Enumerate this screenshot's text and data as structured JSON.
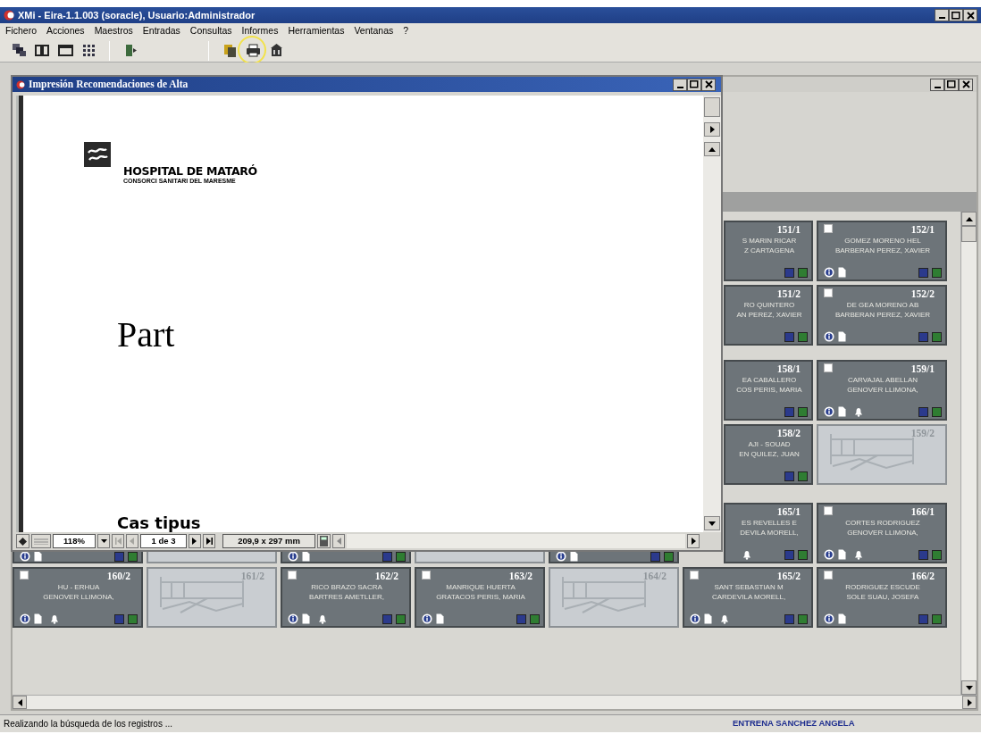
{
  "window": {
    "title": "XMi - Eira-1.1.003 (soracle), Usuario:Administrador"
  },
  "menu": [
    "Fichero",
    "Acciones",
    "Maestros",
    "Entradas",
    "Consultas",
    "Informes",
    "Herramientas",
    "Ventanas",
    "?"
  ],
  "toolbar": [
    {
      "kind": "cascade",
      "highlighted": false
    },
    {
      "kind": "tile",
      "highlighted": false
    },
    {
      "kind": "window",
      "highlighted": false
    },
    {
      "kind": "grid",
      "highlighted": false
    },
    {
      "kind": "separator"
    },
    {
      "kind": "exit",
      "highlighted": false
    },
    {
      "kind": "separator"
    },
    {
      "kind": "copy",
      "highlighted": false
    },
    {
      "kind": "print",
      "highlighted": true
    },
    {
      "kind": "building",
      "highlighted": false
    }
  ],
  "preview": {
    "title": "Impresión Recomendaciones de Alta",
    "document": {
      "org": "HOSPITAL DE MATARÓ",
      "suborg": "CONSORCI SANITARI DEL MARESME",
      "heading": "Part",
      "subheading": "Cas tipus"
    },
    "zoom": "118%",
    "page": "1 de 3",
    "paper": "209,9 x 297 mm",
    "nav": [
      {
        "kind": "first",
        "disabled": true
      },
      {
        "kind": "prev",
        "disabled": true
      },
      {
        "kind": "next",
        "disabled": false
      },
      {
        "kind": "last",
        "disabled": false
      }
    ]
  },
  "bed_rows": [
    [
      {
        "kind": "cut",
        "number": "151/1",
        "lines": [
          "S MARIN RICAR",
          "Z CARTAGENA"
        ],
        "bell": false
      },
      {
        "kind": "bed",
        "number": "152/1",
        "lines": [
          "GOMEZ MORENO HEL",
          "BARBERAN PEREZ, XAVIER"
        ],
        "checked": false,
        "bell": false
      }
    ],
    [
      {
        "kind": "cut",
        "number": "151/2",
        "lines": [
          "RO QUINTERO",
          "AN PEREZ, XAVIER"
        ],
        "bell": false
      },
      {
        "kind": "bed",
        "number": "152/2",
        "lines": [
          "DE GEA MORENO AB",
          "BARBERAN PEREZ, XAVIER"
        ],
        "checked": false,
        "bell": false
      }
    ],
    [
      {
        "kind": "cut",
        "number": "158/1",
        "lines": [
          "EA CABALLERO",
          "COS PERIS, MARIA"
        ],
        "bell": false
      },
      {
        "kind": "bed",
        "number": "159/1",
        "lines": [
          "CARVAJAL ABELLAN",
          "GENOVER LLIMONA,"
        ],
        "checked": false,
        "bell": true
      }
    ],
    [
      {
        "kind": "cut",
        "number": "158/2",
        "lines": [
          "AJI - SOUAD",
          "EN QUILEZ, JUAN"
        ],
        "bell": false
      },
      {
        "kind": "empty",
        "number": "159/2"
      }
    ],
    [
      {
        "kind": "covered-bed"
      },
      {
        "kind": "covered-empty"
      },
      {
        "kind": "covered-bed"
      },
      {
        "kind": "covered-empty"
      },
      {
        "kind": "covered-bed"
      },
      {
        "kind": "cut",
        "number": "165/1",
        "lines": [
          "ES REVELLES E",
          "DEVILA MORELL,"
        ],
        "bell": true
      },
      {
        "kind": "bed",
        "number": "166/1",
        "lines": [
          "CORTES RODRIGUEZ",
          "GENOVER LLIMONA,"
        ],
        "checked": false,
        "bell": true
      }
    ],
    [
      {
        "kind": "bed",
        "number": "160/2",
        "lines": [
          "HU - ERHUA",
          "GENOVER LLIMONA,"
        ],
        "checked": false,
        "bell": true
      },
      {
        "kind": "empty",
        "number": "161/2"
      },
      {
        "kind": "bed",
        "number": "162/2",
        "lines": [
          "RICO BRAZO SACRA",
          "BARTRES AMETLLER,"
        ],
        "checked": false,
        "bell": true
      },
      {
        "kind": "bed",
        "number": "163/2",
        "lines": [
          "MANRIQUE HUERTA",
          "GRATACOS PERIS, MARIA"
        ],
        "checked": false,
        "bell": false
      },
      {
        "kind": "empty",
        "number": "164/2"
      },
      {
        "kind": "bed",
        "number": "165/2",
        "lines": [
          "SANT SEBASTIAN M",
          "CARDEVILA MORELL,"
        ],
        "checked": false,
        "bell": true
      },
      {
        "kind": "bed",
        "number": "166/2",
        "lines": [
          "RODRIGUEZ ESCUDE",
          "SOLE SUAU, JOSEFA"
        ],
        "checked": false,
        "bell": false
      }
    ]
  ],
  "status_bar": {
    "message": "Realizando la búsqueda de los registros ...",
    "user": "ENTRENA SANCHEZ ANGELA"
  }
}
